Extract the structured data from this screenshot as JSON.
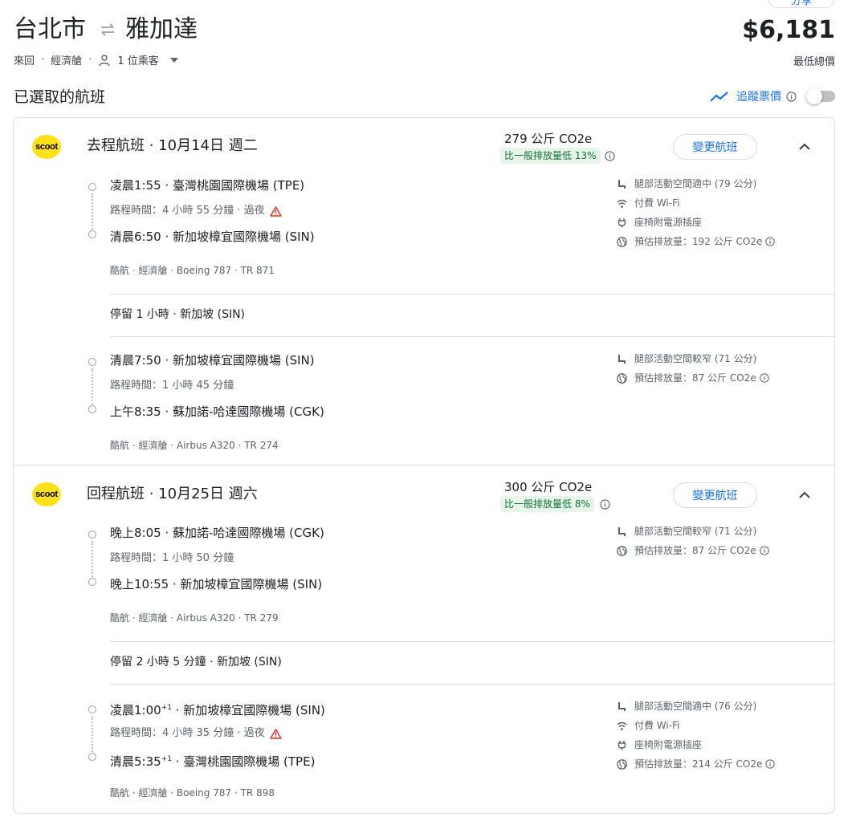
{
  "header": {
    "share_label": "分享",
    "origin": "台北市",
    "destination": "雅加達",
    "trip_type": "來回",
    "cabin": "經濟艙",
    "passengers": "1 位乘客",
    "price": "$6,181",
    "price_note": "最低總價"
  },
  "section": {
    "title": "已選取的航班",
    "track_label": "追蹤票價",
    "track_enabled": false
  },
  "outbound": {
    "airline_logo": "scoot",
    "title": "去程航班 · 10月14日 週二",
    "co2": "279 公斤 CO2e",
    "co2_badge": "比一般排放量低 13%",
    "change_label": "變更航班",
    "segments": [
      {
        "depart": "凌晨1:55 · 臺灣桃園國際機場 (TPE)",
        "duration": "路程時間：4 小時 55 分鐘 · 過夜",
        "arrive": "清晨6:50 · 新加坡樟宜國際機場 (SIN)",
        "meta": "酷航 · 經濟艙 · Boeing 787 · TR 871",
        "amenities": [
          "腿部活動空間適中 (79 公分)",
          "付費 Wi-Fi",
          "座椅附電源插座",
          "預估排放量：192 公斤 CO2e"
        ]
      },
      {
        "depart": "清晨7:50 · 新加坡樟宜國際機場 (SIN)",
        "duration": "路程時間：1 小時 45 分鐘",
        "arrive": "上午8:35 · 蘇加諾-哈達國際機場 (CGK)",
        "meta": "酷航 · 經濟艙 · Airbus A320 · TR 274",
        "amenities": [
          "腿部活動空間較窄 (71 公分)",
          "預估排放量：87 公斤 CO2e"
        ]
      }
    ],
    "layover": "停留 1 小時 · 新加坡 (SIN)"
  },
  "return": {
    "airline_logo": "scoot",
    "title": "回程航班 · 10月25日 週六",
    "co2": "300 公斤 CO2e",
    "co2_badge": "比一般排放量低 8%",
    "change_label": "變更航班",
    "segments": [
      {
        "depart": "晚上8:05 · 蘇加諾-哈達國際機場 (CGK)",
        "duration": "路程時間：1 小時 50 分鐘",
        "arrive": "晚上10:55 · 新加坡樟宜國際機場 (SIN)",
        "meta": "酷航 · 經濟艙 · Airbus A320 · TR 279",
        "amenities": [
          "腿部活動空間較窄 (71 公分)",
          "預估排放量：87 公斤 CO2e"
        ]
      },
      {
        "depart_time": "凌晨1:00",
        "depart_offset": "+1",
        "depart_place": " · 新加坡樟宜國際機場 (SIN)",
        "duration": "路程時間：4 小時 35 分鐘 · 過夜",
        "arrive_time": "清晨5:35",
        "arrive_offset": "+1",
        "arrive_place": " · 臺灣桃園國際機場 (TPE)",
        "meta": "酷航 · 經濟艙 · Boeing 787 · TR 898",
        "amenities": [
          "腿部活動空間適中 (76 公分)",
          "付費 Wi-Fi",
          "座椅附電源插座",
          "預估排放量：214 公斤 CO2e"
        ]
      }
    ],
    "layover": "停留 2 小時 5 分鐘 · 新加坡 (SIN)"
  },
  "icons": {
    "swap": "swap-arrows-icon",
    "person": "person-icon",
    "trend": "trend-line-icon",
    "info": "info-icon",
    "legroom": "seat-icon",
    "wifi": "wifi-icon",
    "power": "power-plug-icon",
    "emissions": "globe-icon",
    "warning": "warning-triangle-icon"
  },
  "colors": {
    "accent": "#1a73e8",
    "badge_bg": "#e6f4ea",
    "badge_text": "#137333",
    "warning": "#d93025",
    "logo_yellow": "#ffe01b"
  }
}
